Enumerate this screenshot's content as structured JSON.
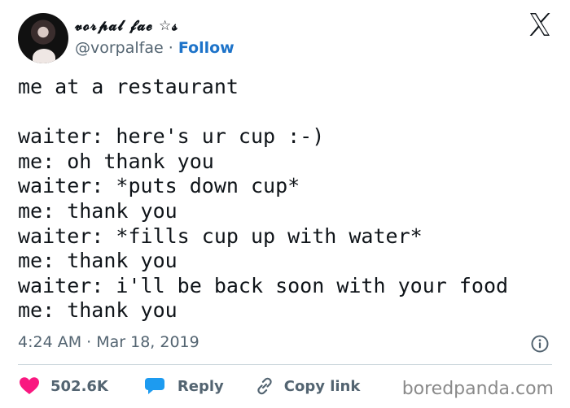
{
  "author": {
    "display_name": "𝓿𝓸𝓻𝓹𝓪𝓵 𝓯𝓪𝓮 ☆𝓼",
    "handle": "@vorpalfae",
    "separator": "·",
    "follow_label": "Follow"
  },
  "tweet": {
    "text": "me at a restaurant\n\nwaiter: here's ur cup :-)\nme: oh thank you\nwaiter: *puts down cup*\nme: thank you\nwaiter: *fills cup up with water*\nme: thank you\nwaiter: i'll be back soon with your food\nme: thank you",
    "timestamp": "4:24 AM · Mar 18, 2019"
  },
  "actions": {
    "like_count": "502.6K",
    "reply_label": "Reply",
    "copy_link_label": "Copy link"
  },
  "watermark": "boredpanda.com",
  "icons": {
    "logo": "x-logo-icon",
    "info": "info-icon",
    "like": "heart-icon",
    "reply": "speech-bubble-icon",
    "copy": "link-icon"
  },
  "colors": {
    "text": "#0f1419",
    "muted": "#536471",
    "follow": "#1d73c9",
    "like": "#f91880",
    "reply": "#1d9bf0"
  }
}
